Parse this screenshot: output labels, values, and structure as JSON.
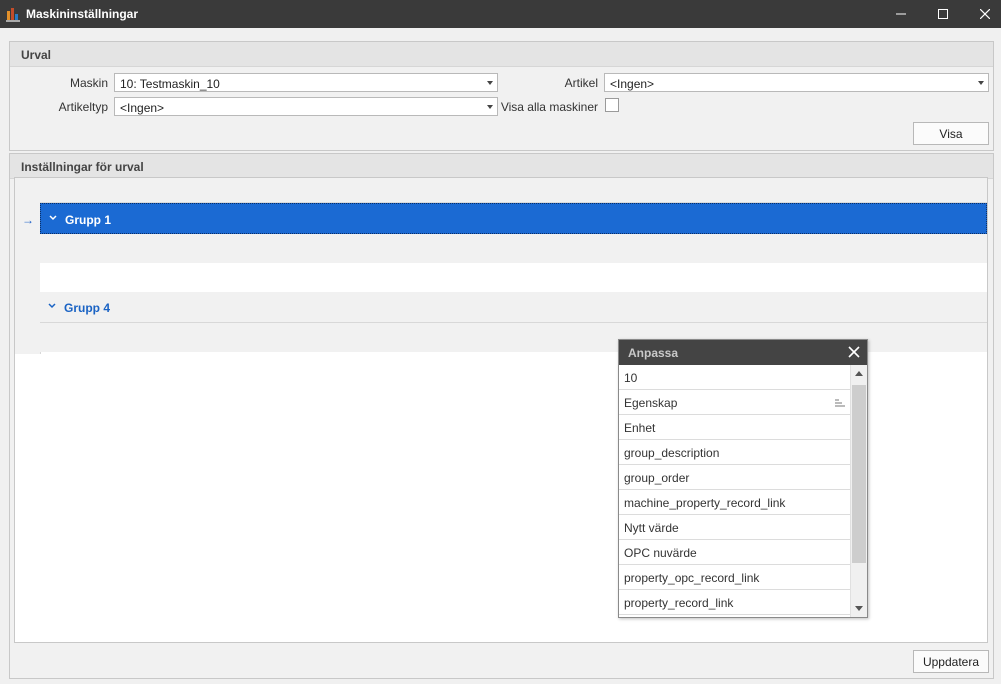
{
  "window": {
    "title": "Maskininställningar"
  },
  "urval": {
    "title": "Urval",
    "maskin": {
      "label": "Maskin",
      "value": "10: Testmaskin_10"
    },
    "artikeltyp": {
      "label": "Artikeltyp",
      "value": "<Ingen>"
    },
    "artikel": {
      "label": "Artikel",
      "value": "<Ingen>"
    },
    "visa_alla": {
      "label": "Visa alla maskiner",
      "checked": false
    },
    "visa_button": "Visa"
  },
  "settings": {
    "title": "Inställningar för urval",
    "groups": [
      {
        "label": "Grupp 1",
        "selected": true
      },
      {
        "label": "Grupp 4",
        "selected": false
      }
    ],
    "update_button": "Uppdatera"
  },
  "customize_popup": {
    "title": "Anpassa",
    "items": [
      "10",
      "Egenskap",
      "Enhet",
      "group_description",
      "group_order",
      "machine_property_record_link",
      "Nytt värde",
      "OPC nuvärde",
      "property_opc_record_link",
      "property_record_link"
    ]
  },
  "colors": {
    "accent": "#1b6ad3",
    "titlebar": "#3a3a3a"
  }
}
